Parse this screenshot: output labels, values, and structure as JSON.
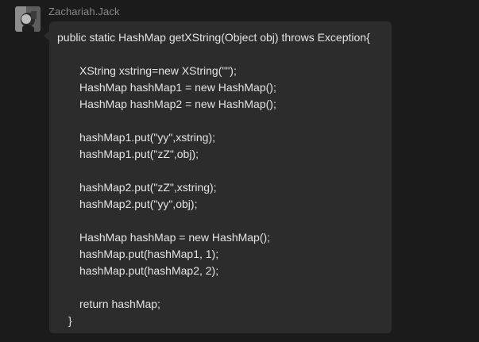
{
  "message": {
    "sender": "Zachariah.Jack",
    "avatar_icon": "user-avatar-icon",
    "code_lines": [
      "public static HashMap getXString(Object obj) throws Exception{",
      "",
      "XString xstring=new XString(\"\");",
      "HashMap hashMap1 = new HashMap();",
      "HashMap hashMap2 = new HashMap();",
      "",
      "hashMap1.put(\"yy\",xstring);",
      "hashMap1.put(\"zZ\",obj);",
      "",
      "hashMap2.put(\"zZ\",xstring);",
      "hashMap2.put(\"yy\",obj);",
      "",
      "HashMap hashMap = new HashMap();",
      "hashMap.put(hashMap1, 1);",
      "hashMap.put(hashMap2, 2);",
      "",
      "return hashMap;",
      "}"
    ]
  },
  "colors": {
    "background": "#1b1b1b",
    "bubble": "#2c2c2c",
    "text": "#e4e4e4",
    "sender_text": "#8a8a8a"
  }
}
